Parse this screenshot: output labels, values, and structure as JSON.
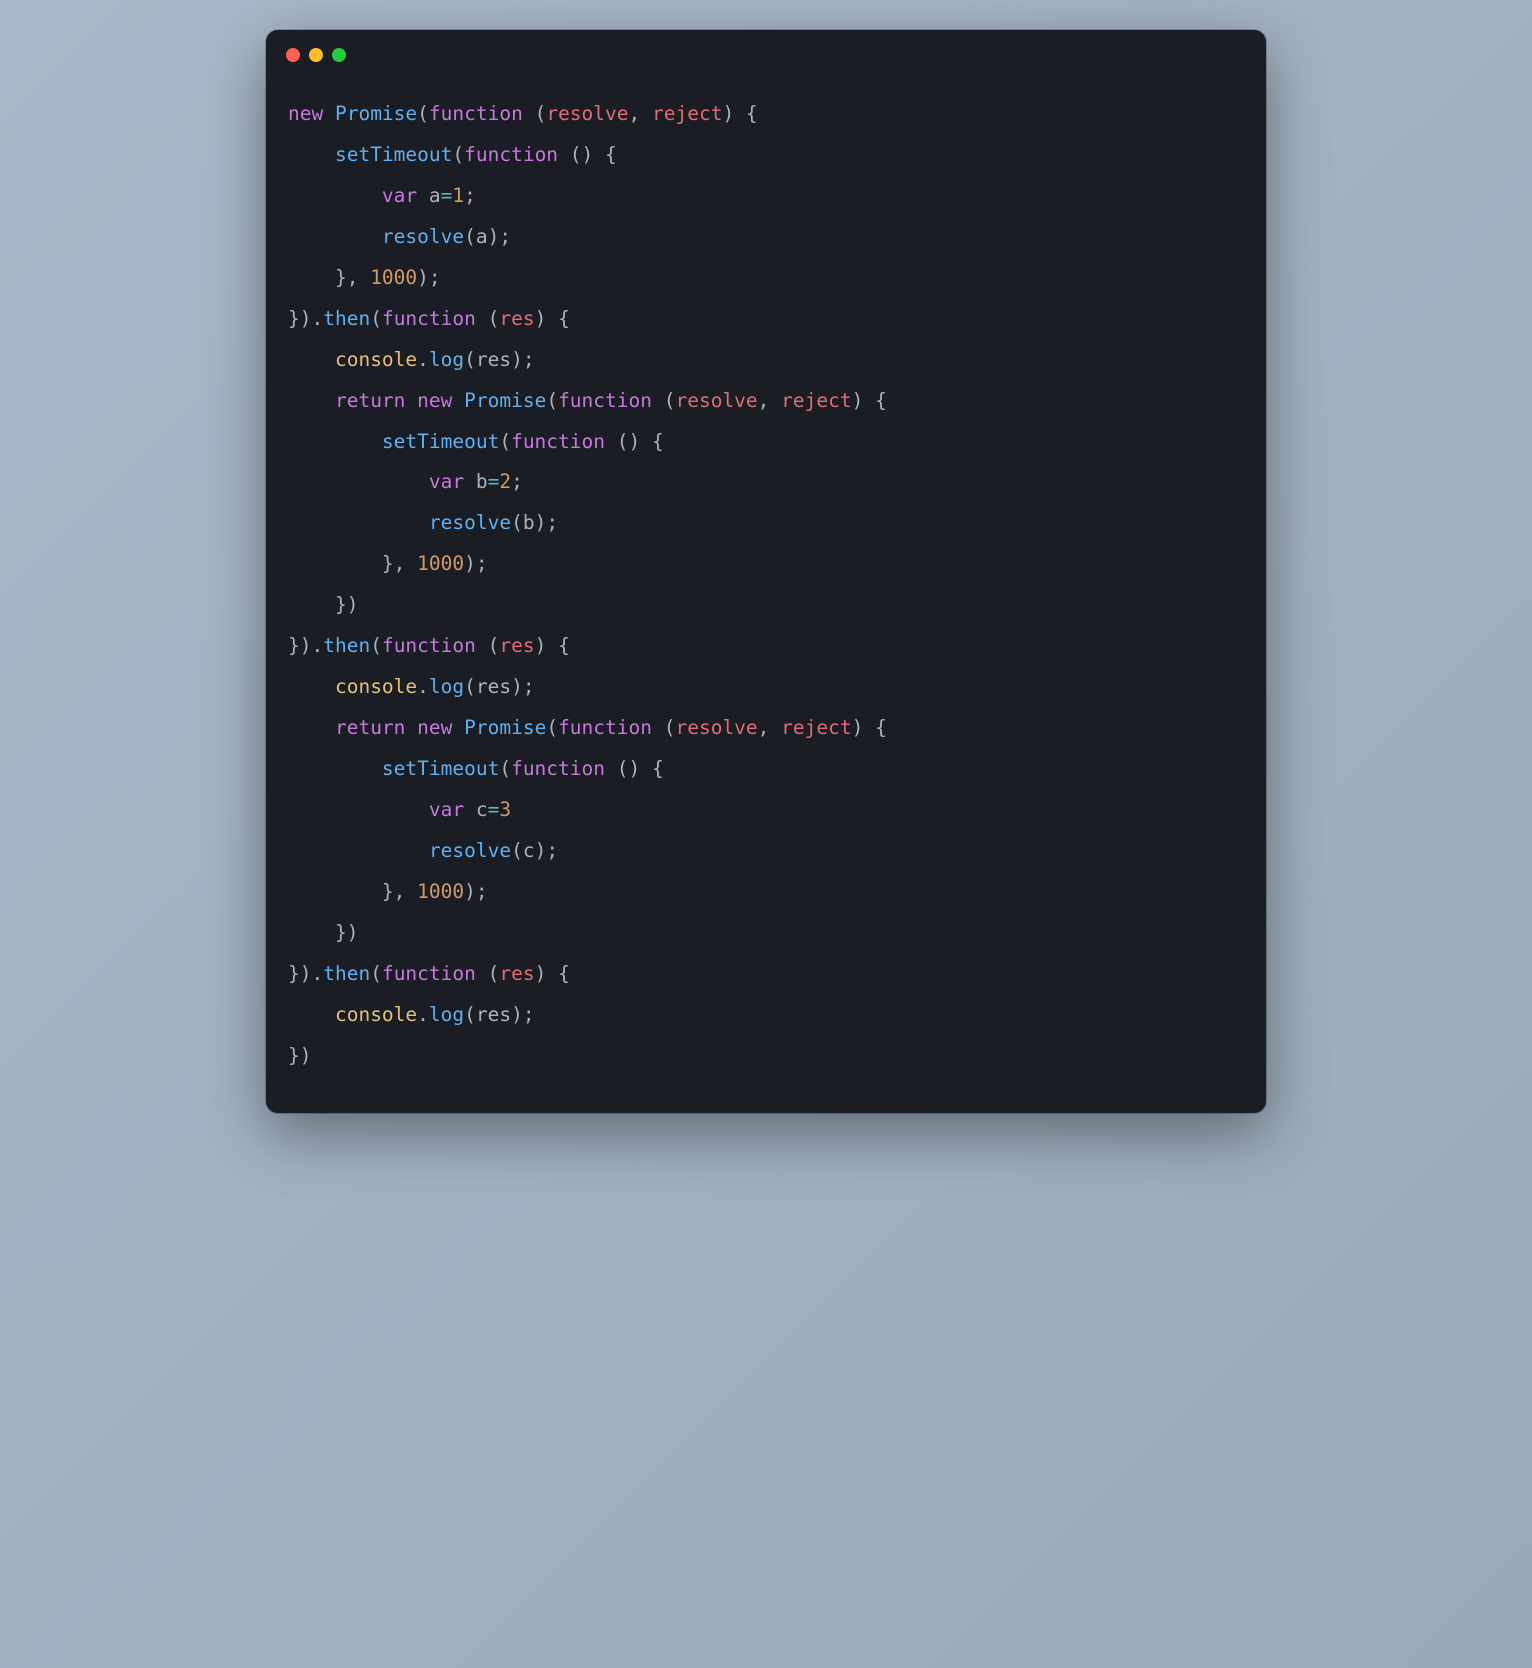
{
  "tokens": [
    {
      "t": "new ",
      "c": "c-keyword"
    },
    {
      "t": "Promise",
      "c": "c-class"
    },
    {
      "t": "(",
      "c": "c-punc"
    },
    {
      "t": "function ",
      "c": "c-keyword"
    },
    {
      "t": "(",
      "c": "c-punc"
    },
    {
      "t": "resolve",
      "c": "c-var"
    },
    {
      "t": ", ",
      "c": "c-punc"
    },
    {
      "t": "reject",
      "c": "c-var"
    },
    {
      "t": ") {",
      "c": "c-punc"
    },
    {
      "t": "\n",
      "c": ""
    },
    {
      "t": "    ",
      "c": ""
    },
    {
      "t": "setTimeout",
      "c": "c-func"
    },
    {
      "t": "(",
      "c": "c-punc"
    },
    {
      "t": "function ",
      "c": "c-keyword"
    },
    {
      "t": "() {",
      "c": "c-punc"
    },
    {
      "t": "\n",
      "c": ""
    },
    {
      "t": "        ",
      "c": ""
    },
    {
      "t": "var ",
      "c": "c-keyword"
    },
    {
      "t": "a",
      "c": "c-default"
    },
    {
      "t": "=",
      "c": "c-op"
    },
    {
      "t": "1",
      "c": "c-num"
    },
    {
      "t": ";",
      "c": "c-punc"
    },
    {
      "t": "\n",
      "c": ""
    },
    {
      "t": "        ",
      "c": ""
    },
    {
      "t": "resolve",
      "c": "c-func"
    },
    {
      "t": "(",
      "c": "c-punc"
    },
    {
      "t": "a",
      "c": "c-default"
    },
    {
      "t": ");",
      "c": "c-punc"
    },
    {
      "t": "\n",
      "c": ""
    },
    {
      "t": "    }, ",
      "c": "c-punc"
    },
    {
      "t": "1000",
      "c": "c-num"
    },
    {
      "t": ");",
      "c": "c-punc"
    },
    {
      "t": "\n",
      "c": ""
    },
    {
      "t": "}).",
      "c": "c-punc"
    },
    {
      "t": "then",
      "c": "c-func"
    },
    {
      "t": "(",
      "c": "c-punc"
    },
    {
      "t": "function ",
      "c": "c-keyword"
    },
    {
      "t": "(",
      "c": "c-punc"
    },
    {
      "t": "res",
      "c": "c-var"
    },
    {
      "t": ") {",
      "c": "c-punc"
    },
    {
      "t": "\n",
      "c": ""
    },
    {
      "t": "    ",
      "c": ""
    },
    {
      "t": "console",
      "c": "c-builtin"
    },
    {
      "t": ".",
      "c": "c-punc"
    },
    {
      "t": "log",
      "c": "c-func"
    },
    {
      "t": "(",
      "c": "c-punc"
    },
    {
      "t": "res",
      "c": "c-default"
    },
    {
      "t": ");",
      "c": "c-punc"
    },
    {
      "t": "\n",
      "c": ""
    },
    {
      "t": "    ",
      "c": ""
    },
    {
      "t": "return ",
      "c": "c-keyword"
    },
    {
      "t": "new ",
      "c": "c-keyword"
    },
    {
      "t": "Promise",
      "c": "c-class"
    },
    {
      "t": "(",
      "c": "c-punc"
    },
    {
      "t": "function ",
      "c": "c-keyword"
    },
    {
      "t": "(",
      "c": "c-punc"
    },
    {
      "t": "resolve",
      "c": "c-var"
    },
    {
      "t": ", ",
      "c": "c-punc"
    },
    {
      "t": "reject",
      "c": "c-var"
    },
    {
      "t": ") {",
      "c": "c-punc"
    },
    {
      "t": "\n",
      "c": ""
    },
    {
      "t": "        ",
      "c": ""
    },
    {
      "t": "setTimeout",
      "c": "c-func"
    },
    {
      "t": "(",
      "c": "c-punc"
    },
    {
      "t": "function ",
      "c": "c-keyword"
    },
    {
      "t": "() {",
      "c": "c-punc"
    },
    {
      "t": "\n",
      "c": ""
    },
    {
      "t": "            ",
      "c": ""
    },
    {
      "t": "var ",
      "c": "c-keyword"
    },
    {
      "t": "b",
      "c": "c-default"
    },
    {
      "t": "=",
      "c": "c-op"
    },
    {
      "t": "2",
      "c": "c-num"
    },
    {
      "t": ";",
      "c": "c-punc"
    },
    {
      "t": "\n",
      "c": ""
    },
    {
      "t": "            ",
      "c": ""
    },
    {
      "t": "resolve",
      "c": "c-func"
    },
    {
      "t": "(",
      "c": "c-punc"
    },
    {
      "t": "b",
      "c": "c-default"
    },
    {
      "t": ");",
      "c": "c-punc"
    },
    {
      "t": "\n",
      "c": ""
    },
    {
      "t": "        }, ",
      "c": "c-punc"
    },
    {
      "t": "1000",
      "c": "c-num"
    },
    {
      "t": ");",
      "c": "c-punc"
    },
    {
      "t": "\n",
      "c": ""
    },
    {
      "t": "    })",
      "c": "c-punc"
    },
    {
      "t": "\n",
      "c": ""
    },
    {
      "t": "}).",
      "c": "c-punc"
    },
    {
      "t": "then",
      "c": "c-func"
    },
    {
      "t": "(",
      "c": "c-punc"
    },
    {
      "t": "function ",
      "c": "c-keyword"
    },
    {
      "t": "(",
      "c": "c-punc"
    },
    {
      "t": "res",
      "c": "c-var"
    },
    {
      "t": ") {",
      "c": "c-punc"
    },
    {
      "t": "\n",
      "c": ""
    },
    {
      "t": "    ",
      "c": ""
    },
    {
      "t": "console",
      "c": "c-builtin"
    },
    {
      "t": ".",
      "c": "c-punc"
    },
    {
      "t": "log",
      "c": "c-func"
    },
    {
      "t": "(",
      "c": "c-punc"
    },
    {
      "t": "res",
      "c": "c-default"
    },
    {
      "t": ");",
      "c": "c-punc"
    },
    {
      "t": "\n",
      "c": ""
    },
    {
      "t": "    ",
      "c": ""
    },
    {
      "t": "return ",
      "c": "c-keyword"
    },
    {
      "t": "new ",
      "c": "c-keyword"
    },
    {
      "t": "Promise",
      "c": "c-class"
    },
    {
      "t": "(",
      "c": "c-punc"
    },
    {
      "t": "function ",
      "c": "c-keyword"
    },
    {
      "t": "(",
      "c": "c-punc"
    },
    {
      "t": "resolve",
      "c": "c-var"
    },
    {
      "t": ", ",
      "c": "c-punc"
    },
    {
      "t": "reject",
      "c": "c-var"
    },
    {
      "t": ") {",
      "c": "c-punc"
    },
    {
      "t": "\n",
      "c": ""
    },
    {
      "t": "        ",
      "c": ""
    },
    {
      "t": "setTimeout",
      "c": "c-func"
    },
    {
      "t": "(",
      "c": "c-punc"
    },
    {
      "t": "function ",
      "c": "c-keyword"
    },
    {
      "t": "() {",
      "c": "c-punc"
    },
    {
      "t": "\n",
      "c": ""
    },
    {
      "t": "            ",
      "c": ""
    },
    {
      "t": "var ",
      "c": "c-keyword"
    },
    {
      "t": "c",
      "c": "c-default"
    },
    {
      "t": "=",
      "c": "c-op"
    },
    {
      "t": "3",
      "c": "c-num"
    },
    {
      "t": "\n",
      "c": ""
    },
    {
      "t": "            ",
      "c": ""
    },
    {
      "t": "resolve",
      "c": "c-func"
    },
    {
      "t": "(",
      "c": "c-punc"
    },
    {
      "t": "c",
      "c": "c-default"
    },
    {
      "t": ");",
      "c": "c-punc"
    },
    {
      "t": "\n",
      "c": ""
    },
    {
      "t": "        }, ",
      "c": "c-punc"
    },
    {
      "t": "1000",
      "c": "c-num"
    },
    {
      "t": ");",
      "c": "c-punc"
    },
    {
      "t": "\n",
      "c": ""
    },
    {
      "t": "    })",
      "c": "c-punc"
    },
    {
      "t": "\n",
      "c": ""
    },
    {
      "t": "}).",
      "c": "c-punc"
    },
    {
      "t": "then",
      "c": "c-func"
    },
    {
      "t": "(",
      "c": "c-punc"
    },
    {
      "t": "function ",
      "c": "c-keyword"
    },
    {
      "t": "(",
      "c": "c-punc"
    },
    {
      "t": "res",
      "c": "c-var"
    },
    {
      "t": ") {",
      "c": "c-punc"
    },
    {
      "t": "\n",
      "c": ""
    },
    {
      "t": "    ",
      "c": ""
    },
    {
      "t": "console",
      "c": "c-builtin"
    },
    {
      "t": ".",
      "c": "c-punc"
    },
    {
      "t": "log",
      "c": "c-func"
    },
    {
      "t": "(",
      "c": "c-punc"
    },
    {
      "t": "res",
      "c": "c-default"
    },
    {
      "t": ");",
      "c": "c-punc"
    },
    {
      "t": "\n",
      "c": ""
    },
    {
      "t": "})",
      "c": "c-punc"
    }
  ]
}
